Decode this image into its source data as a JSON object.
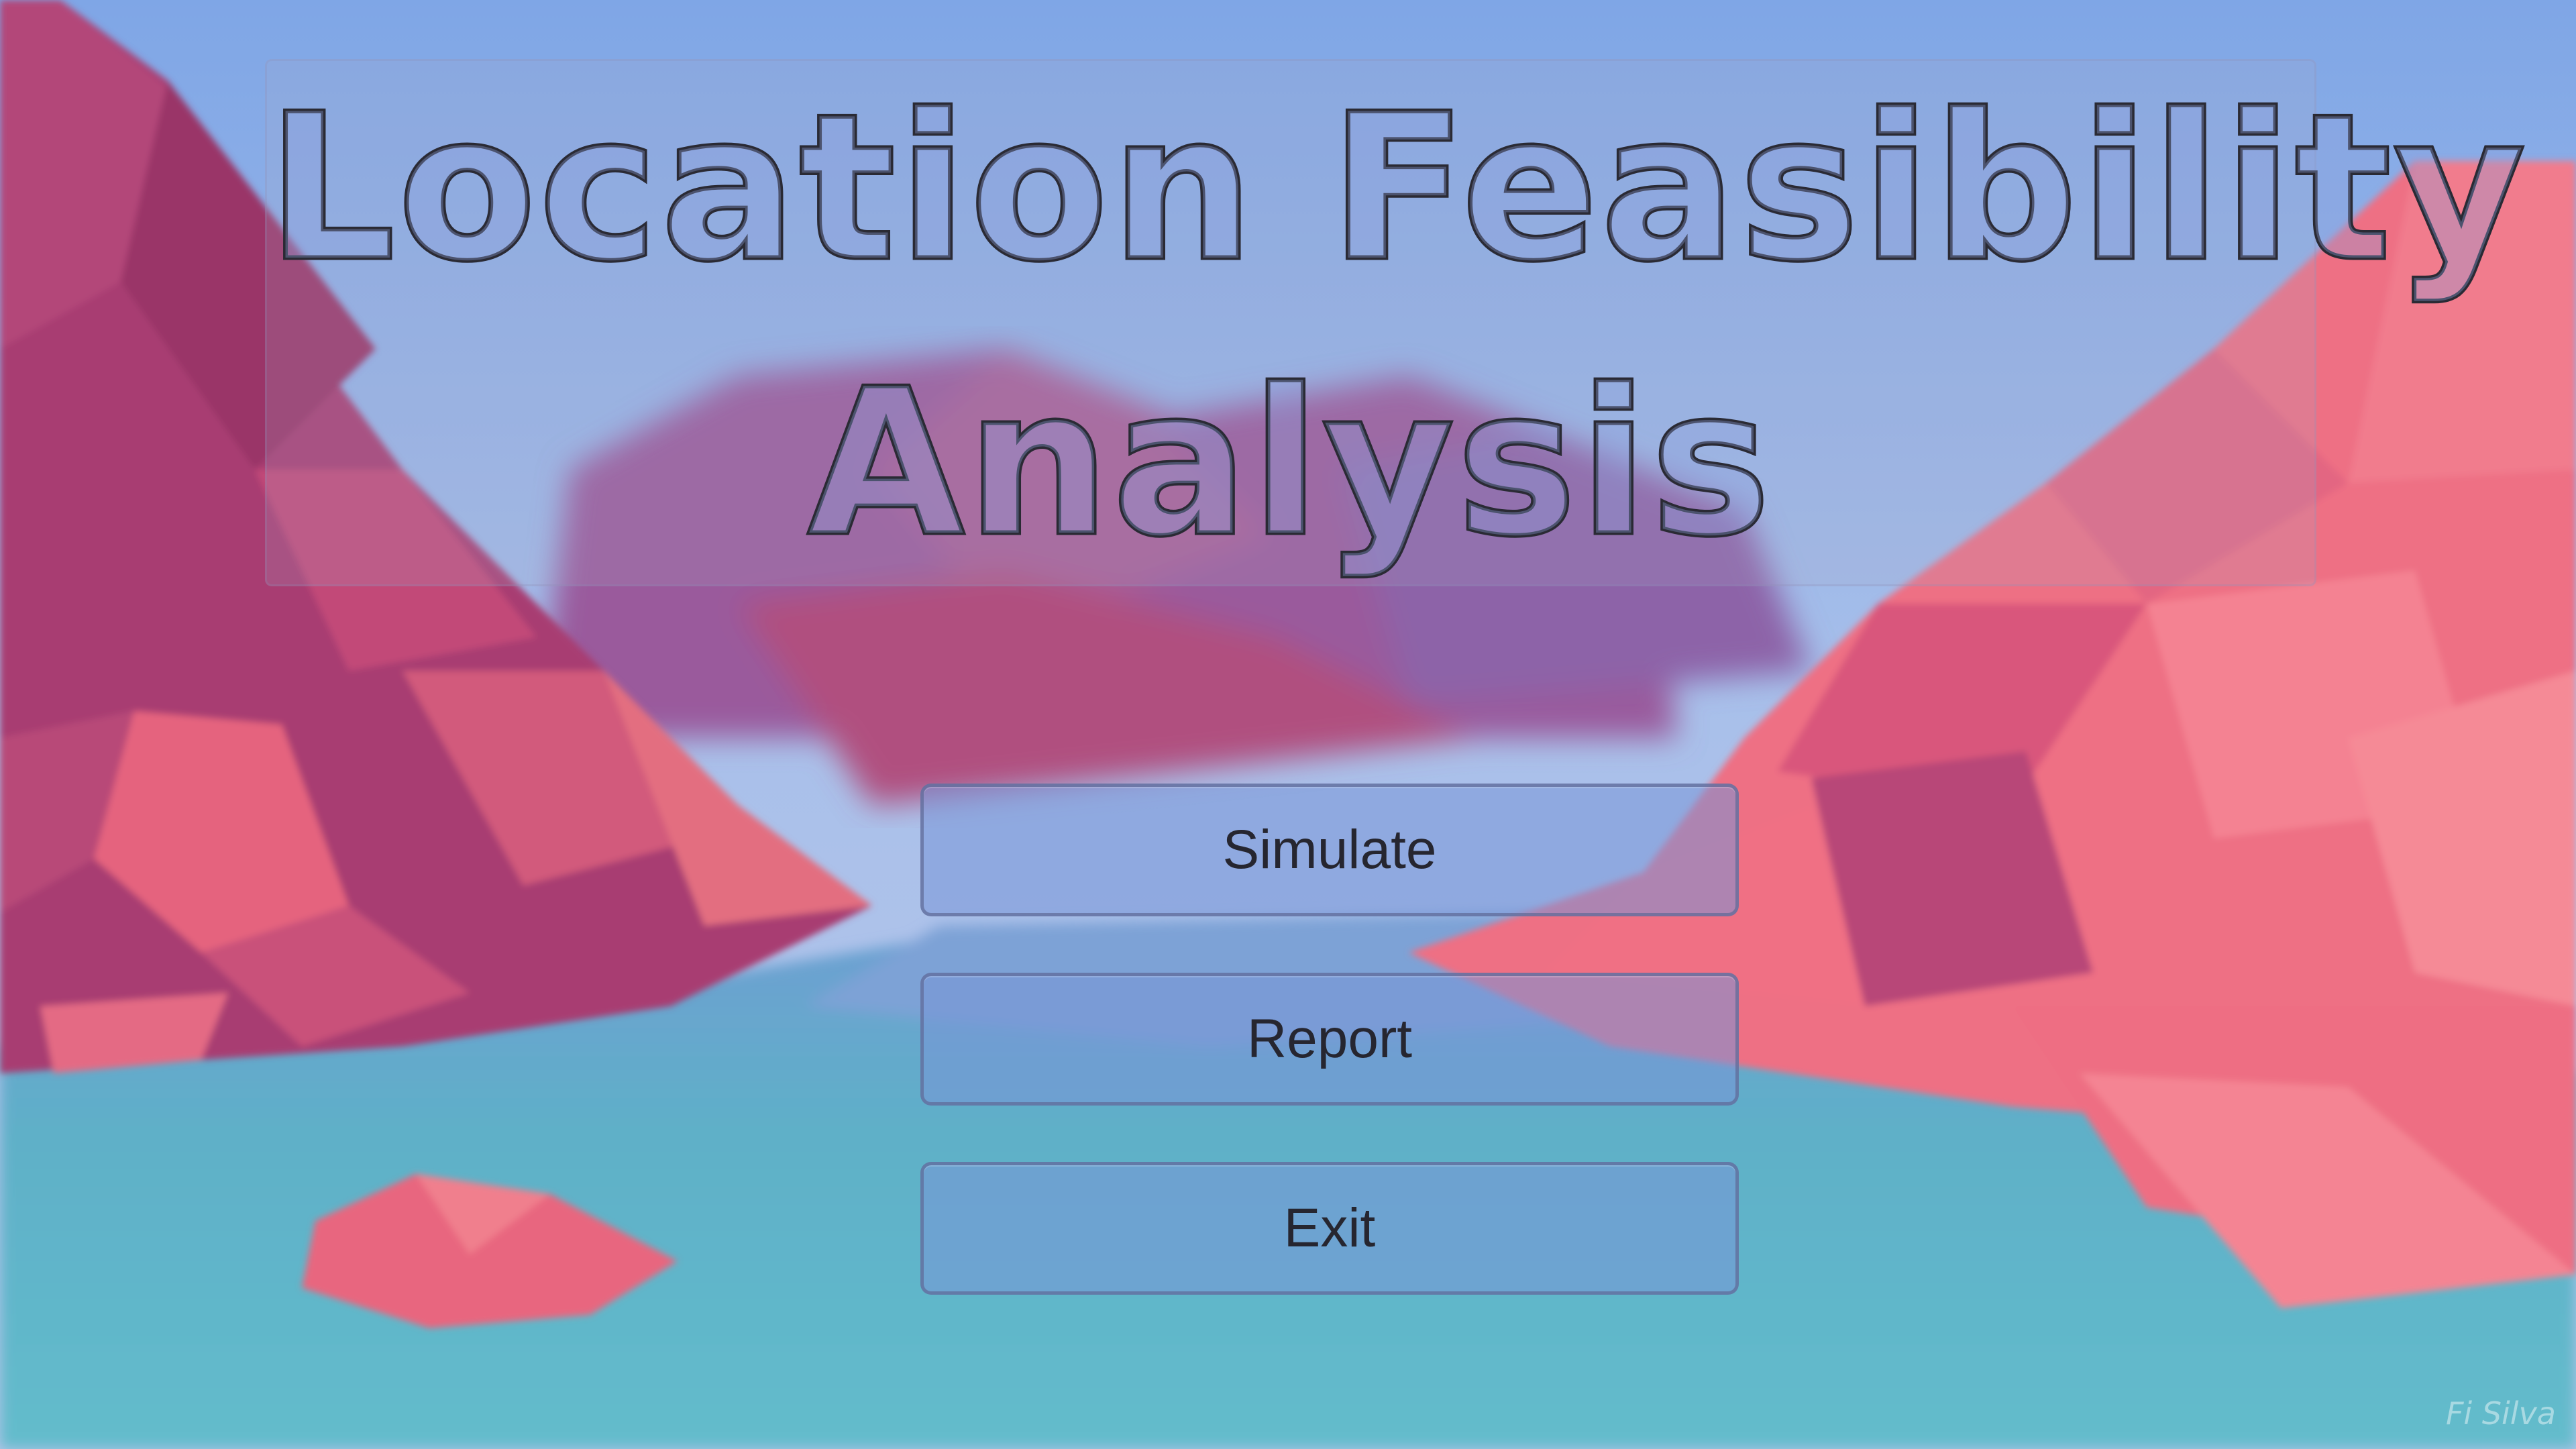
{
  "title": {
    "line1": "Location Feasibility",
    "line2": "Analysis"
  },
  "menu": {
    "simulate_label": "Simulate",
    "report_label": "Report",
    "exit_label": "Exit"
  },
  "watermark": "Fi Silva",
  "colors": {
    "sky": "#8fb2e6",
    "mountain_magenta": "#a83c72",
    "mountain_coral": "#ee6f84",
    "water": "#5fb3c8",
    "button_fill": "#7896d7",
    "text_dark": "#262630"
  }
}
